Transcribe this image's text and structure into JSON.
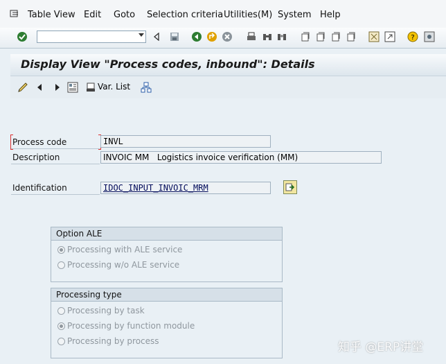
{
  "menubar": {
    "items": [
      {
        "label": "Table View"
      },
      {
        "label": "Edit"
      },
      {
        "label": "Goto"
      },
      {
        "label": "Selection criteria"
      },
      {
        "label": "Utilities(M)"
      },
      {
        "label": "System"
      },
      {
        "label": "Help"
      }
    ]
  },
  "title": "Display View \"Process codes, inbound\": Details",
  "app_toolbar": {
    "var_list_label": "Var. List"
  },
  "form": {
    "process_code": {
      "label": "Process code",
      "value": "INVL"
    },
    "description": {
      "label": "Description",
      "value": "INVOIC MM   Logistics invoice verification (MM)"
    },
    "identification": {
      "label": "Identification",
      "value": "IDOC_INPUT_INVOIC_MRM"
    }
  },
  "option_ale": {
    "title": "Option ALE",
    "options": [
      {
        "label": "Processing with ALE service",
        "selected": true
      },
      {
        "label": "Processing w/o ALE service",
        "selected": false
      }
    ]
  },
  "processing_type": {
    "title": "Processing type",
    "options": [
      {
        "label": "Processing by task",
        "selected": false
      },
      {
        "label": "Processing by function module",
        "selected": true
      },
      {
        "label": "Processing by process",
        "selected": false
      }
    ]
  },
  "watermark": "知乎 @ERP讲堂",
  "colors": {
    "title_bg": "#dde6ed",
    "red_bracket": "#d93030",
    "body_bg": "#e9f0f5"
  }
}
